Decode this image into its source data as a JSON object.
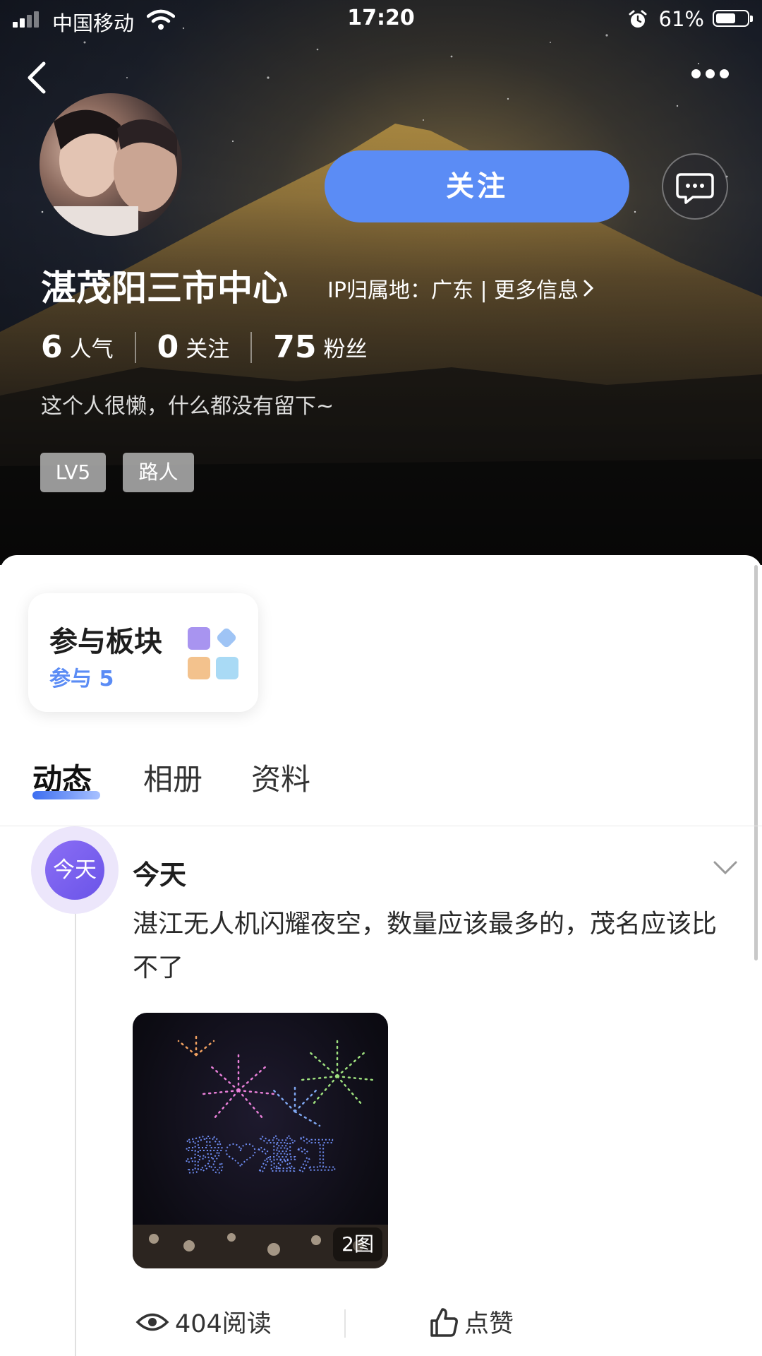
{
  "status_bar": {
    "carrier": "中国移动",
    "time": "17:20",
    "battery": "61%"
  },
  "header": {
    "follow_label": "关注"
  },
  "profile": {
    "name": "湛茂阳三市中心",
    "ip_info": "IP归属地：广东 | 更多信息",
    "stats": [
      {
        "value": "6",
        "label": "人气"
      },
      {
        "value": "0",
        "label": "关注"
      },
      {
        "value": "75",
        "label": "粉丝"
      }
    ],
    "bio": "这个人很懒，什么都没有留下~",
    "tags": [
      "LV5",
      "路人"
    ]
  },
  "boards_card": {
    "title": "参与板块",
    "count_label": "参与 5"
  },
  "tabs": [
    "动态",
    "相册",
    "资料"
  ],
  "feed": {
    "badge": "今天",
    "date_label": "今天",
    "post": {
      "text": "湛江无人机闪耀夜空，数量应该最多的，茂名应该比不了",
      "image_count": "2图",
      "image_text": "我❤湛江",
      "reads": "404阅读",
      "like_label": "点赞"
    }
  },
  "colors": {
    "accent": "#5b8cf5",
    "badge_purple": "#7a60ef"
  }
}
